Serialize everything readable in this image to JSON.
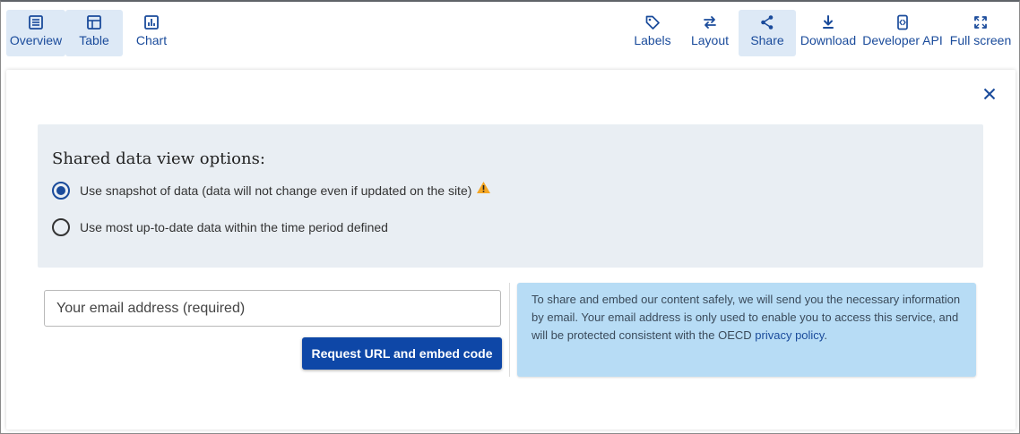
{
  "toolbar": {
    "left": [
      {
        "label": "Overview",
        "icon": "list-icon",
        "active": true
      },
      {
        "label": "Table",
        "icon": "table-icon",
        "active": true
      },
      {
        "label": "Chart",
        "icon": "chart-icon",
        "active": false
      }
    ],
    "right": [
      {
        "label": "Labels",
        "icon": "tag-icon",
        "active": false
      },
      {
        "label": "Layout",
        "icon": "swap-icon",
        "active": false
      },
      {
        "label": "Share",
        "icon": "share-icon",
        "active": true
      },
      {
        "label": "Download",
        "icon": "download-icon",
        "active": false
      },
      {
        "label": "Developer API",
        "icon": "code-icon",
        "active": false
      },
      {
        "label": "Full screen",
        "icon": "fullscreen-icon",
        "active": false
      }
    ]
  },
  "share_panel": {
    "close_icon": "close-icon",
    "options_title": "Shared data view options:",
    "option_snapshot": "Use snapshot of data (data will not change even if updated on the site)",
    "option_latest": "Use most up-to-date data within the time period defined",
    "selected_option": "snapshot",
    "email_placeholder": "Your email address (required)",
    "email_value": "",
    "submit_label": "Request URL and embed code",
    "info_text": "To share and embed our content safely, we will send you the necessary information by email. Your email address is only used to enable you to access this service, and will be protected consistent with the OECD ",
    "info_link": "privacy policy",
    "info_end": "."
  },
  "colors": {
    "accent": "#1a4b9b",
    "button_bg": "#0e47a7",
    "active_tab_bg": "#dde9f6",
    "options_bg": "#e9eef3",
    "info_bg": "#b7dcf5",
    "warning": "#f5a623"
  }
}
